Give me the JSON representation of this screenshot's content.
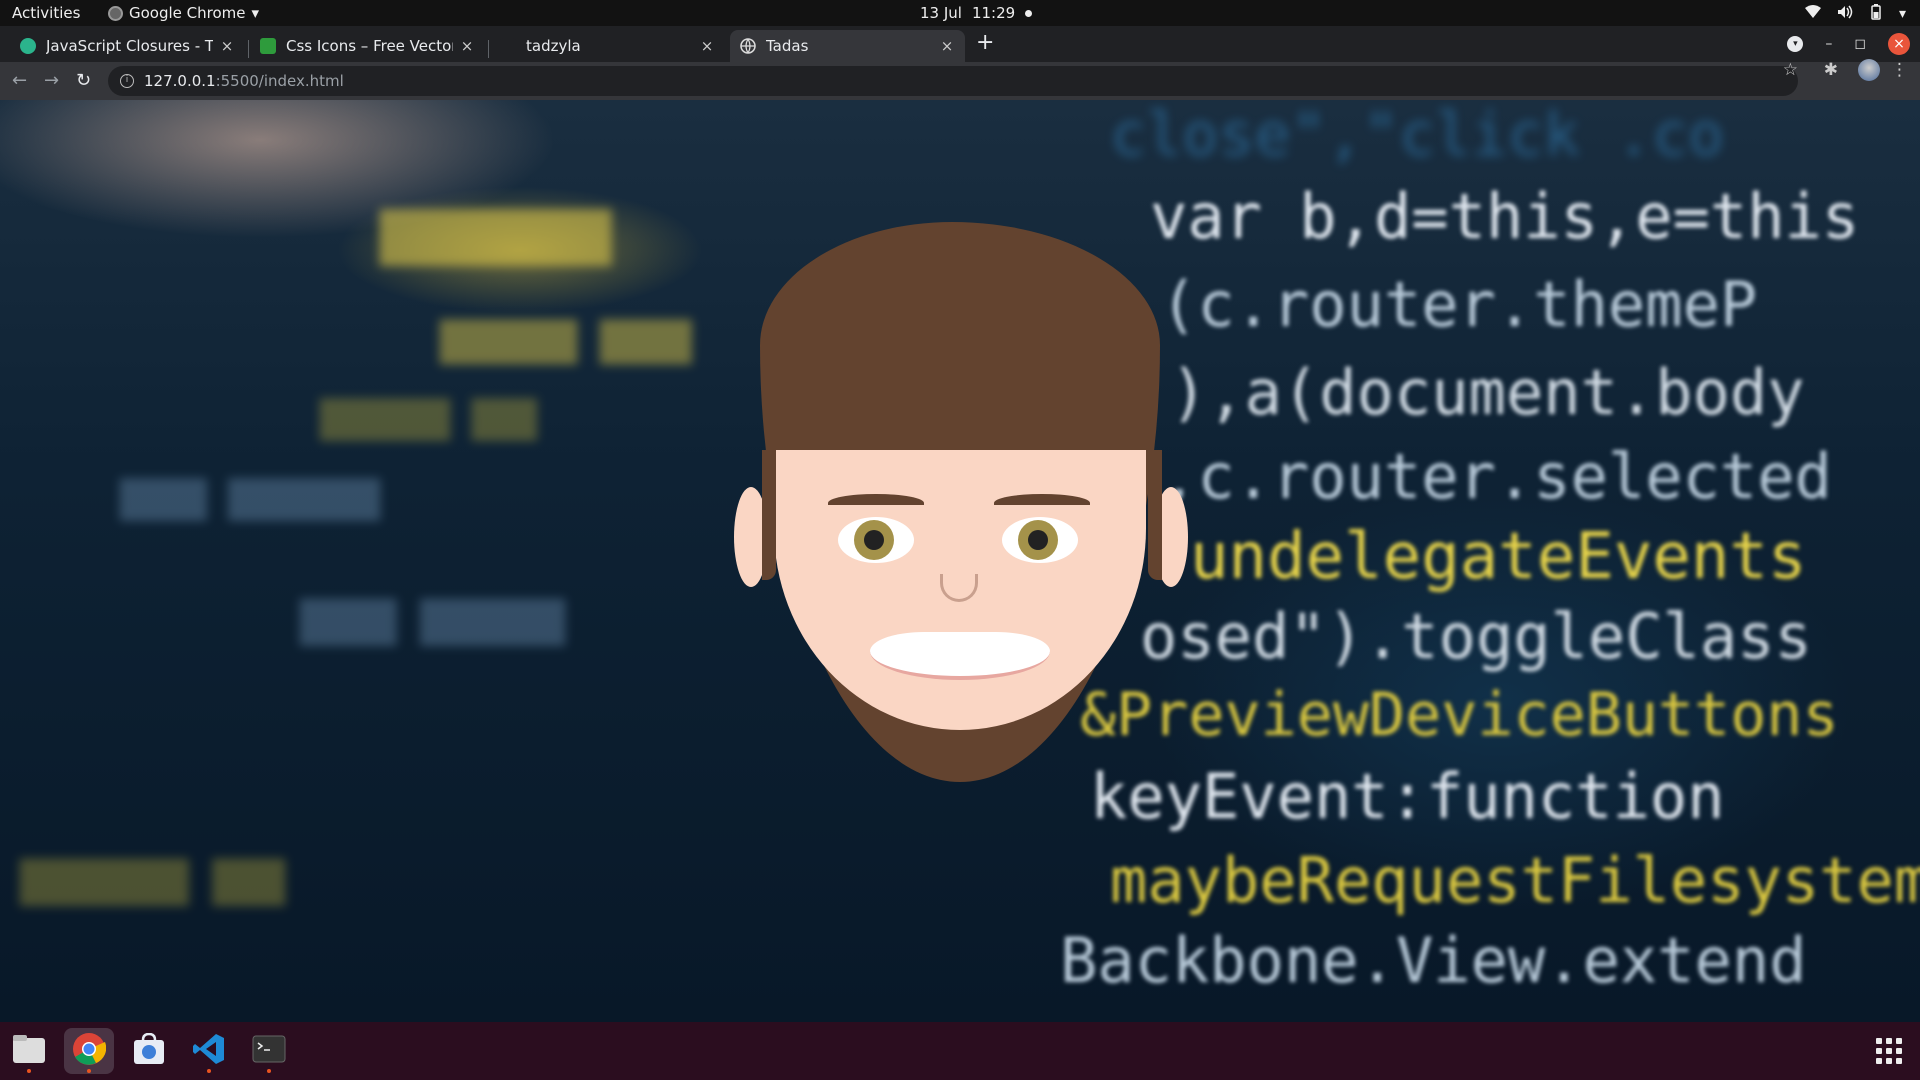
{
  "topbar": {
    "activities": "Activities",
    "app_name": "Google Chrome",
    "date": "13 Jul",
    "time": "11:29"
  },
  "tabs": [
    {
      "title": "JavaScript Closures - Tuto",
      "favicon_color": "#2bb48c",
      "close": "×"
    },
    {
      "title": "Css Icons – Free Vector Do",
      "favicon_color": "#2e9b3c",
      "close": "×"
    },
    {
      "title": "tadzyla",
      "favicon_color": "#202124",
      "close": "×"
    },
    {
      "title": "Tadas",
      "favicon_color": "#9aa0a6",
      "close": "×"
    }
  ],
  "new_tab": "+",
  "toolbar": {
    "url_host": "127.0.0.1",
    "url_path": ":5500/index.html"
  },
  "colors": {
    "hair": "#63432f",
    "skin": "#fad6c4",
    "iris": "#a4924a",
    "ubuntu_accent": "#e95420"
  },
  "background_code": {
    "line1": "close\",\"click .co",
    "line2": "var b,d=this,e=this",
    "line3": "(c.router.themeP",
    "line4": "),a(document.body",
    "line5": ",c.router.selected",
    "line6": "undelegateEvents",
    "line7": "osed\").toggleClass",
    "line8": "&PreviewDeviceButtons",
    "line9": "keyEvent:function",
    "line10": "maybeRequestFilesystem",
    "line11": "Backbone.View.extend"
  },
  "dock": [
    "files-icon",
    "chrome-icon",
    "software-icon",
    "vscode-icon",
    "terminal-icon"
  ]
}
